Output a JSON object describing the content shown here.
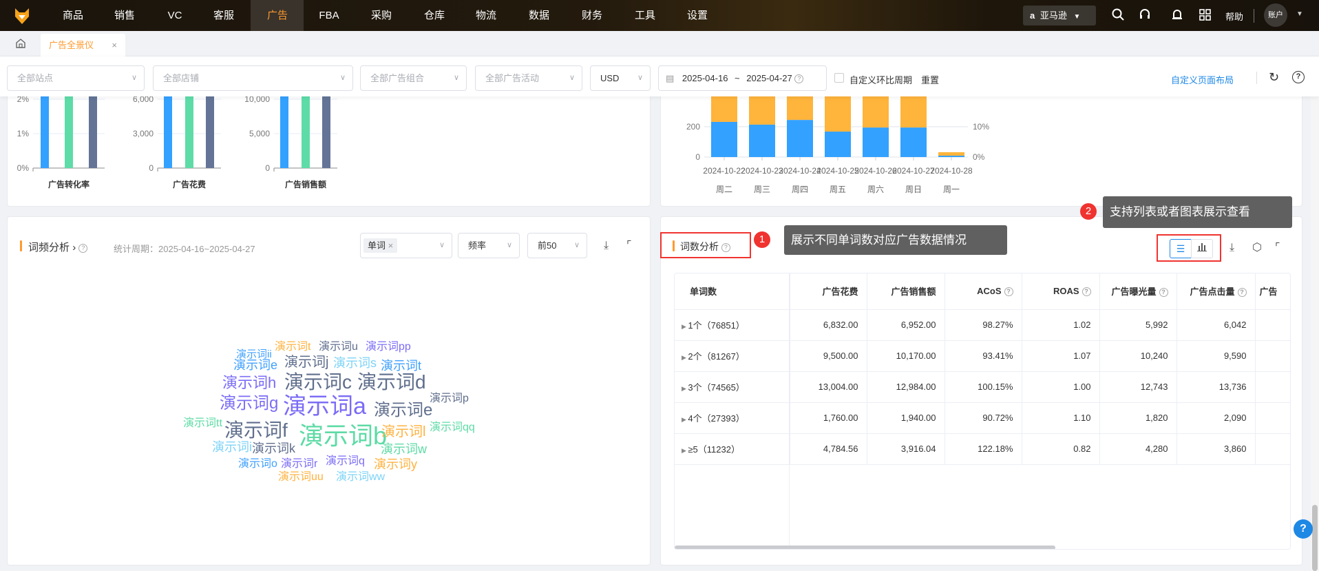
{
  "nav": {
    "items": [
      "商品",
      "销售",
      "VC",
      "客服",
      "广告",
      "FBA",
      "采购",
      "仓库",
      "物流",
      "数据",
      "财务",
      "工具",
      "设置"
    ],
    "active": "广告",
    "marketplace": "亚马逊",
    "help": "帮助",
    "account": "账户"
  },
  "tabs": {
    "active_tab": "广告全景仪",
    "close": "×"
  },
  "filters": {
    "site": "全部站点",
    "store": "全部店铺",
    "portfolio": "全部广告组合",
    "campaign": "全部广告活动",
    "currency": "USD",
    "date_start": "2025-04-16",
    "date_sep": "~",
    "date_end": "2025-04-27",
    "compare_label": "自定义环比周期",
    "reset": "重置",
    "custom_layout": "自定义页面布局"
  },
  "chart_data": [
    {
      "type": "bar",
      "title": "广告转化率",
      "yticks": [
        "0%",
        "1%",
        "2%"
      ],
      "ylim": [
        0,
        2
      ],
      "values": [
        2.1,
        2.1,
        2.1
      ],
      "colors": [
        "#33a1ff",
        "#5ddca8",
        "#637497"
      ]
    },
    {
      "type": "bar",
      "title": "广告花费",
      "yticks": [
        "0",
        "3,000",
        "6,000"
      ],
      "ylim": [
        0,
        6000
      ],
      "values": [
        6500,
        6500,
        6500
      ],
      "colors": [
        "#33a1ff",
        "#5ddca8",
        "#637497"
      ]
    },
    {
      "type": "bar",
      "title": "广告销售额",
      "yticks": [
        "0",
        "5,000",
        "10,000"
      ],
      "ylim": [
        0,
        10000
      ],
      "values": [
        11000,
        11000,
        11000
      ],
      "colors": [
        "#33a1ff",
        "#5ddca8",
        "#637497"
      ]
    },
    {
      "type": "bar",
      "stacked": true,
      "categories": [
        "2024-10-22",
        "2024-10-23",
        "2024-10-24",
        "2024-10-25",
        "2024-10-26",
        "2024-10-27",
        "2024-10-28"
      ],
      "weekdays": [
        "周二",
        "周三",
        "周四",
        "周五",
        "周六",
        "周日",
        "周一"
      ],
      "series": [
        {
          "name": "blue",
          "color": "#33a1ff",
          "values": [
            232,
            214,
            245,
            168,
            195,
            195,
            9
          ]
        },
        {
          "name": "orange",
          "color": "#ffb43c",
          "values": [
            300,
            300,
            300,
            300,
            300,
            300,
            23
          ]
        }
      ],
      "yticks_left": [
        "0",
        "200"
      ],
      "yticks_right": [
        "0%",
        "10%"
      ],
      "ylim": [
        0,
        400
      ]
    }
  ],
  "wordfreq": {
    "title": "词频分析",
    "period": "统计周期：2025-04-16~2025-04-27",
    "tag": "单词",
    "sort": "频率",
    "top": "前50",
    "words": [
      "演示词t",
      "演示词u",
      "演示词pp",
      "演示词ii",
      "演示词e",
      "演示词j",
      "演示词s",
      "演示词t",
      "演示词h",
      "演示词c",
      "演示词d",
      "演示词p",
      "演示词g",
      "演示词a",
      "演示词e",
      "演示词tt",
      "演示词f",
      "演示词b",
      "演示词l",
      "演示词qq",
      "演示词i",
      "演示词k",
      "演示词w",
      "演示词o",
      "演示词r",
      "演示词q",
      "演示词y",
      "演示词uu",
      "演示词ww"
    ]
  },
  "wordcount": {
    "title": "词数分析",
    "columns": [
      "单词数",
      "广告花费",
      "广告销售额",
      "ACoS",
      "ROAS",
      "广告曝光量",
      "广告点击量",
      "广告"
    ],
    "rows": [
      [
        "1个（76851）",
        "6,832.00",
        "6,952.00",
        "98.27%",
        "1.02",
        "5,992",
        "6,042"
      ],
      [
        "2个（81267）",
        "9,500.00",
        "10,170.00",
        "93.41%",
        "1.07",
        "10,240",
        "9,590"
      ],
      [
        "3个（74565）",
        "13,004.00",
        "12,984.00",
        "100.15%",
        "1.00",
        "12,743",
        "13,736"
      ],
      [
        "4个（27393）",
        "1,760.00",
        "1,940.00",
        "90.72%",
        "1.10",
        "1,820",
        "2,090"
      ],
      [
        "≥5（11232）",
        "4,784.56",
        "3,916.04",
        "122.18%",
        "0.82",
        "4,280",
        "3,860"
      ]
    ]
  },
  "annotations": {
    "m1": "1",
    "tip1": "展示不同单词数对应广告数据情况",
    "m2": "2",
    "tip2": "支持列表或者图表展示查看"
  }
}
